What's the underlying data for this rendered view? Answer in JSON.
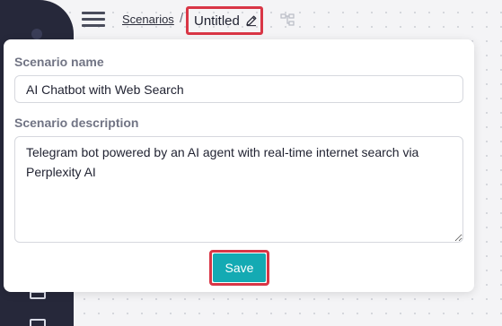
{
  "breadcrumb": {
    "parent_label": "Scenarios",
    "separator": "/",
    "current_title": "Untitled"
  },
  "modal": {
    "name_label": "Scenario name",
    "name_value": "AI Chatbot with Web Search",
    "description_label": "Scenario description",
    "description_value": "Telegram bot powered by an AI agent with real-time internet search via Perplexity AI",
    "save_label": "Save"
  },
  "icons": {
    "menu": "hamburger-menu-icon",
    "edit": "pencil-icon",
    "flow": "flow-diagram-icon"
  },
  "colors": {
    "sidebar": "#26283a",
    "accent": "#14aab3",
    "highlight": "#d93646"
  }
}
